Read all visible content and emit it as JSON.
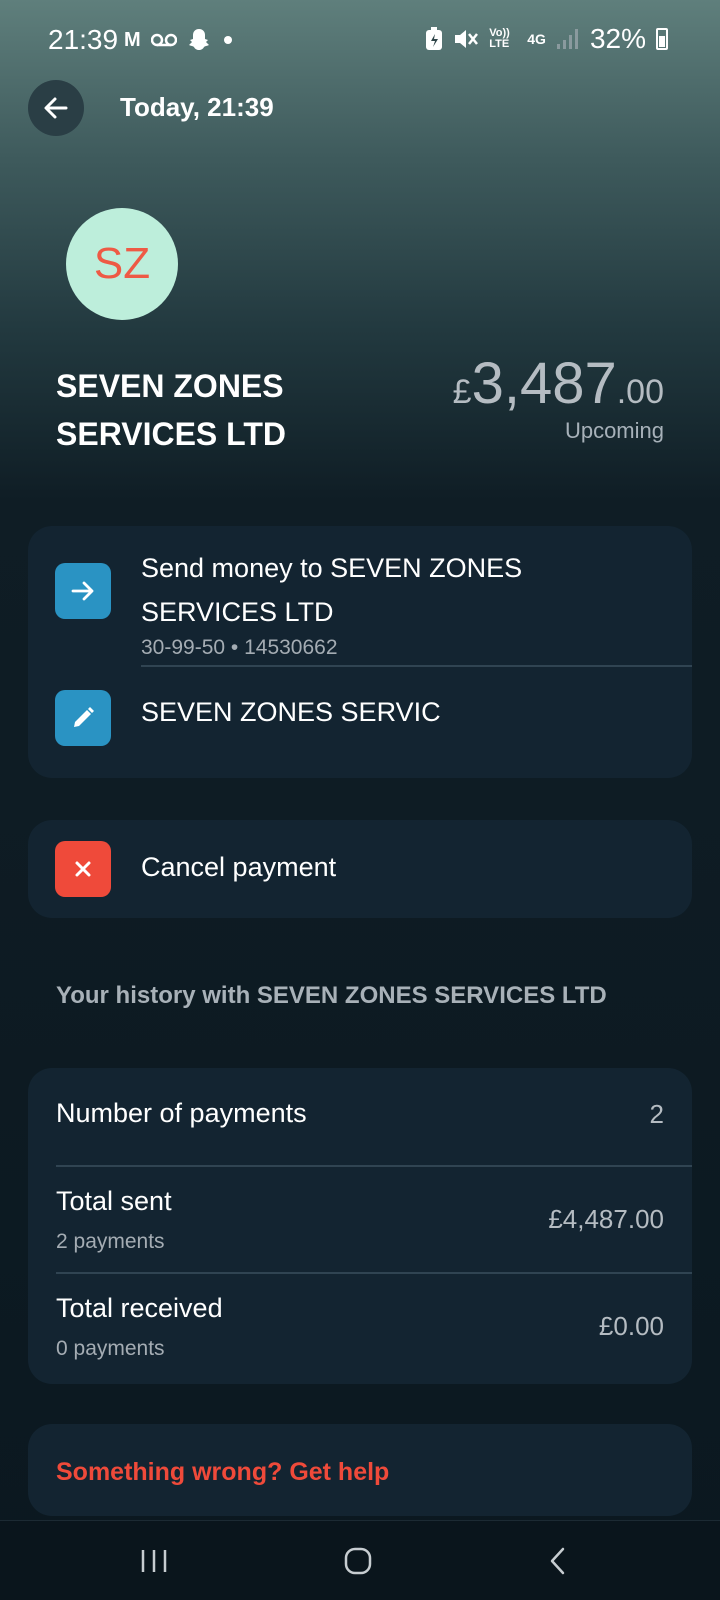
{
  "status_bar": {
    "time": "21:39",
    "left_icons": [
      "gmail-icon",
      "voicemail-icon",
      "snapchat-icon",
      "dot-icon"
    ],
    "battery": "32%",
    "volte": "Vo)) LTE",
    "network": "4G"
  },
  "header": {
    "title": "Today, 21:39"
  },
  "merchant": {
    "initials": "SZ",
    "name": "SEVEN ZONES SERVICES LTD",
    "avatar_bg": "#bdeedb",
    "avatar_fg": "#ee5a45"
  },
  "amount": {
    "currency": "£",
    "whole": "3,487",
    "decimal": ".00",
    "status": "Upcoming"
  },
  "actions": {
    "send_label": "Send money to SEVEN ZONES SERVICES LTD",
    "send_sub": "30-99-50 • 14530662",
    "reference": "SEVEN ZONES SERVIC",
    "cancel_label": "Cancel payment"
  },
  "history": {
    "title": "Your history with SEVEN ZONES SERVICES LTD",
    "rows": [
      {
        "label": "Number of payments",
        "sub": "",
        "value": "2"
      },
      {
        "label": "Total sent",
        "sub": "2 payments",
        "value": "£4,487.00"
      },
      {
        "label": "Total received",
        "sub": "0 payments",
        "value": "£0.00"
      }
    ]
  },
  "help": {
    "label": "Something wrong? Get help"
  },
  "colors": {
    "accent_blue": "#2a93c3",
    "accent_red": "#ef4a3a",
    "card_bg": "#132431"
  }
}
